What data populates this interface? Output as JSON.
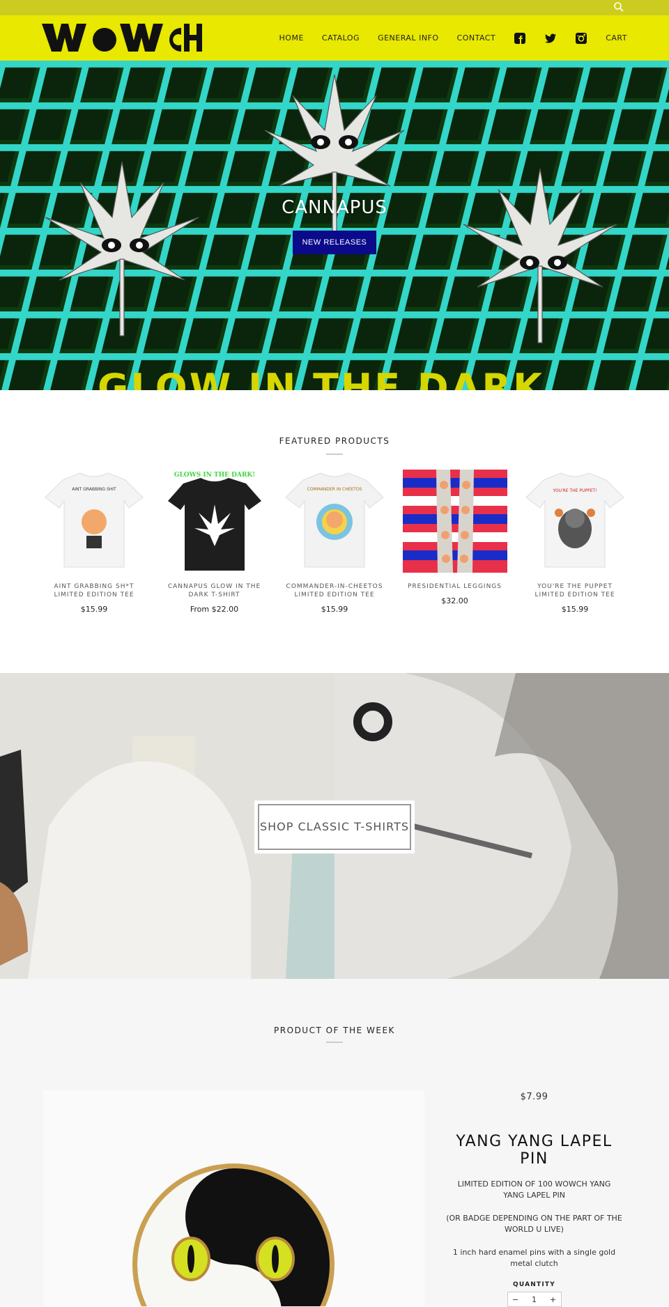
{
  "header": {
    "logo_text": "WOWCH",
    "nav": [
      {
        "label": "HOME"
      },
      {
        "label": "CATALOG"
      },
      {
        "label": "GENERAL INFO"
      },
      {
        "label": "CONTACT"
      }
    ],
    "cart_label": "CART",
    "social_icons": [
      "facebook-icon",
      "twitter-icon",
      "instagram-icon"
    ],
    "colors": {
      "topbar": "#cccc20",
      "header": "#e8e800"
    }
  },
  "hero": {
    "title": "CANNAPUS",
    "button_label": "NEW RELEASES",
    "bottom_text": "GLOW IN THE DARK",
    "button_color": "#0a0a8a"
  },
  "featured": {
    "title": "FEATURED PRODUCTS",
    "products": [
      {
        "name": "AINT GRABBING SH*T LIMITED EDITION TEE",
        "price": "$15.99",
        "art_text": "AINT GRABBING SHIT"
      },
      {
        "name": "CANNAPUS GLOW IN THE DARK T-SHIRT",
        "price": "From $22.00",
        "art_text": "GLOWS IN THE DARK!"
      },
      {
        "name": "COMMANDER-IN-CHEETOS LIMITED EDITION TEE",
        "price": "$15.99",
        "art_text": "COMMANDER IN CHEETOS"
      },
      {
        "name": "PRESIDENTIAL LEGGINGS",
        "price": "$32.00"
      },
      {
        "name": "YOU'RE THE PUPPET LIMITED EDITION TEE",
        "price": "$15.99",
        "art_text": "YOU'RE THE PUPPET!"
      }
    ]
  },
  "collection": {
    "button_label": "SHOP CLASSIC T-SHIRTS"
  },
  "potw": {
    "title": "PRODUCT OF THE WEEK",
    "price": "$7.99",
    "name": "YANG YANG LAPEL PIN",
    "desc": [
      "LIMITED EDITION OF 100 WOWCH YANG YANG LAPEL PIN",
      "(OR BADGE DEPENDING ON THE PART OF THE WORLD U LIVE)",
      "1 inch hard enamel pins with a single gold metal clutch"
    ],
    "quantity_label": "QUANTITY",
    "quantity_value": "1",
    "minus": "−",
    "plus": "+"
  }
}
